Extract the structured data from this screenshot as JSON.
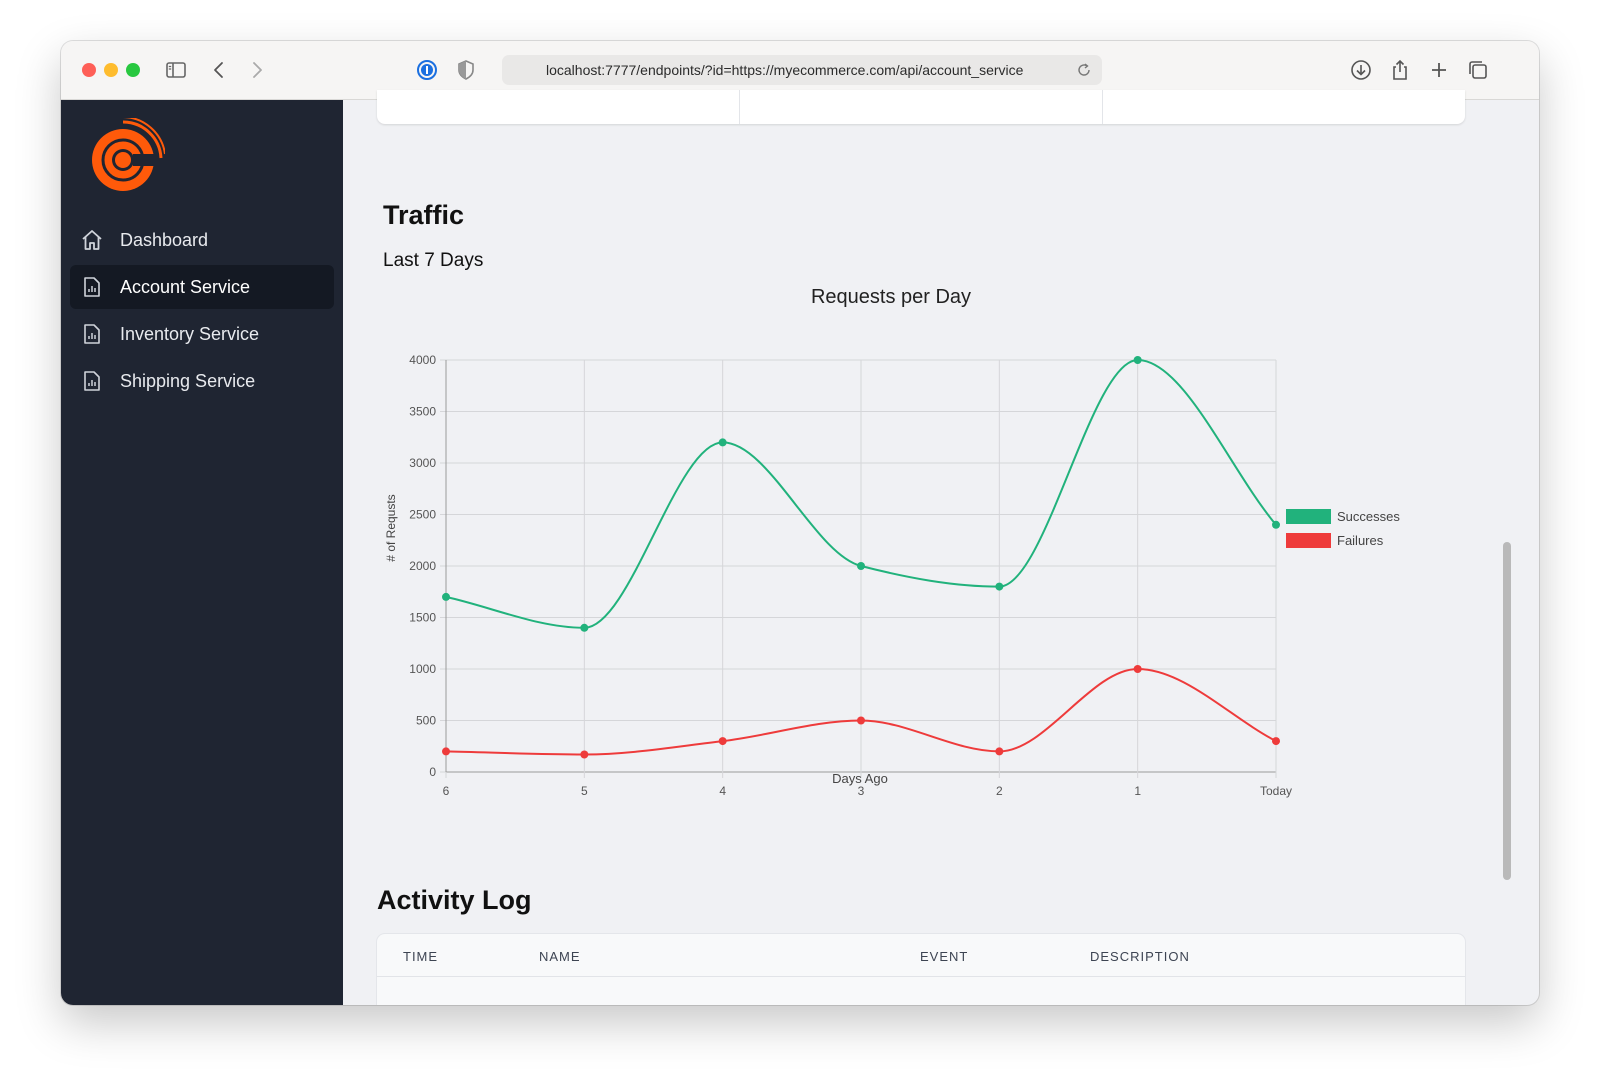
{
  "browser": {
    "url": "localhost:7777/endpoints/?id=https://myecommerce.com/api/account_service"
  },
  "sidebar": {
    "items": [
      {
        "label": "Dashboard",
        "icon": "home-icon"
      },
      {
        "label": "Account Service",
        "icon": "report-icon",
        "active": true
      },
      {
        "label": "Inventory Service",
        "icon": "report-icon"
      },
      {
        "label": "Shipping Service",
        "icon": "report-icon"
      }
    ]
  },
  "main": {
    "traffic_heading": "Traffic",
    "range_label": "Last 7 Days",
    "activity_heading": "Activity Log",
    "activity_columns": [
      "TIME",
      "NAME",
      "EVENT",
      "DESCRIPTION"
    ]
  },
  "colors": {
    "sidebar_bg": "#1f2532",
    "accent_logo": "#ff5a0a",
    "successes": "#21b27c",
    "failures": "#ee3b3b"
  },
  "chart_data": {
    "type": "line",
    "title": "Requests per Day",
    "xlabel": "Days Ago",
    "ylabel": "# of Requsts",
    "categories": [
      "6",
      "5",
      "4",
      "3",
      "2",
      "1",
      "Today"
    ],
    "ylim": [
      0,
      4000
    ],
    "yticks": [
      0,
      500,
      1000,
      1500,
      2000,
      2500,
      3000,
      3500,
      4000
    ],
    "grid": true,
    "legend": "right",
    "series": [
      {
        "name": "Successes",
        "color": "#21b27c",
        "values": [
          1700,
          1400,
          3200,
          2000,
          1800,
          4000,
          2400
        ]
      },
      {
        "name": "Failures",
        "color": "#ee3b3b",
        "values": [
          200,
          170,
          300,
          500,
          200,
          1000,
          300
        ]
      }
    ]
  }
}
